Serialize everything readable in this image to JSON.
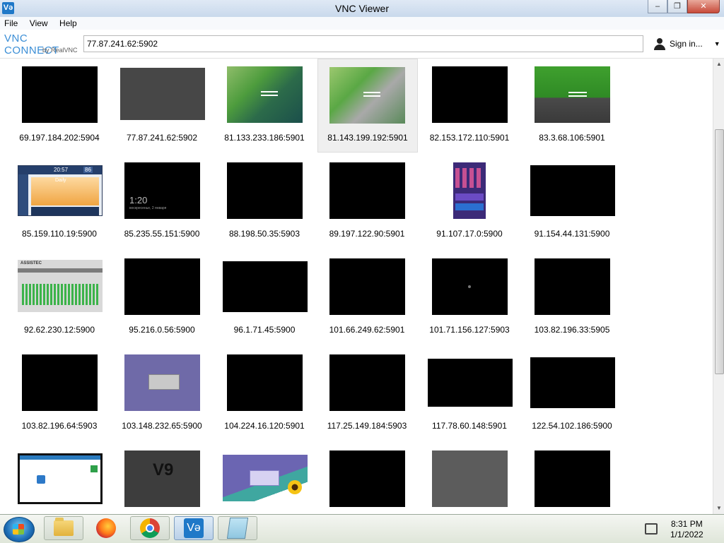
{
  "window": {
    "title": "VNC Viewer",
    "app_icon_text": "Və",
    "minimize_glyph": "–",
    "maximize_glyph": "❐",
    "close_glyph": "✕"
  },
  "menu": {
    "items": [
      "File",
      "View",
      "Help"
    ]
  },
  "brand": {
    "logo_line1": "VNC CONNECT",
    "logo_line2": "by RealVNC"
  },
  "address": {
    "value": "77.87.241.62:5902"
  },
  "account": {
    "signin_label": "Sign in...",
    "caret": "▼"
  },
  "grid": {
    "rows": [
      [
        "69.197.184.202:5904",
        "77.87.241.62:5902",
        "81.133.233.186:5901",
        "81.143.199.192:5901",
        "82.153.172.110:5901",
        "83.3.68.106:5901"
      ],
      [
        "85.159.110.19:5900",
        "85.235.55.151:5900",
        "88.198.50.35:5903",
        "89.197.122.90:5901",
        "91.107.17.0:5900",
        "91.154.44.131:5900"
      ],
      [
        "92.62.230.12:5900",
        "95.216.0.56:5900",
        "96.1.71.45:5900",
        "101.66.249.62:5901",
        "101.71.156.127:5903",
        "103.82.196.33:5905"
      ],
      [
        "103.82.196.64:5903",
        "103.148.232.65:5900",
        "104.224.16.120:5901",
        "117.25.149.184:5903",
        "117.78.60.148:5901",
        "122.54.102.186:5900"
      ]
    ],
    "selected": "81.143.199.192:5901",
    "thumb_texts": {
      "lock_time": "1:20",
      "lock_date": "воскресенье, 2 января",
      "thermo_title": "Daily",
      "thermo_time": "20:57",
      "thermo_value": "86",
      "eq_brand": "ASSISTEC",
      "v9": "V9"
    }
  },
  "scrollbar": {
    "up": "▲",
    "down": "▼"
  },
  "taskbar": {
    "items": [
      "start-button",
      "explorer",
      "firefox",
      "chrome",
      "vnc-viewer",
      "notepad"
    ],
    "vnc_icon_text": "Və",
    "clock_time": "8:31 PM",
    "clock_date": "1/1/2022"
  }
}
